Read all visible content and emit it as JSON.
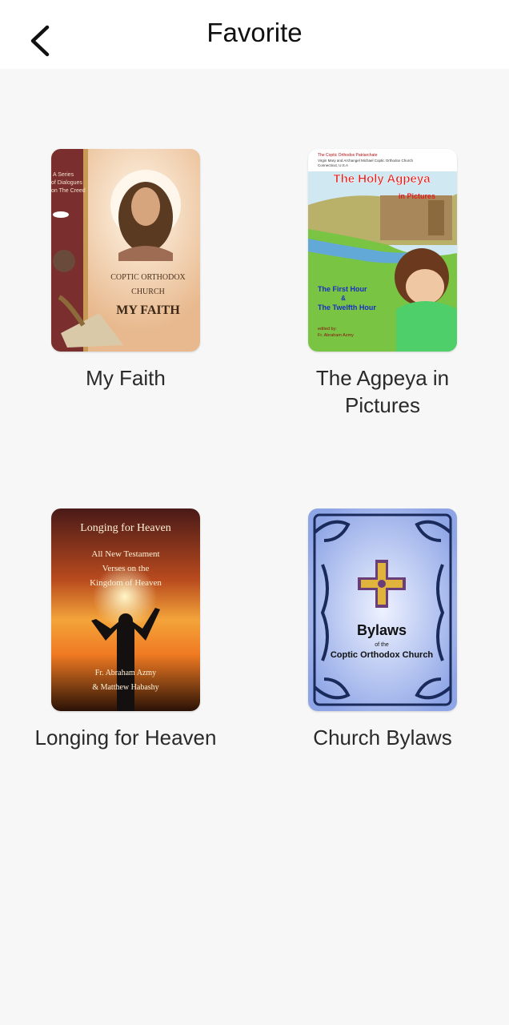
{
  "header": {
    "title": "Favorite",
    "back_icon": "chevron-left-icon"
  },
  "books": [
    {
      "title": "My Faith",
      "cover": {
        "series": [
          "A Series",
          "of Dialogues",
          "on The Creed"
        ],
        "line1": "COPTIC ORTHODOX",
        "line2": "CHURCH",
        "line3": "MY FAITH"
      }
    },
    {
      "title": "The Agpeya in Pictures",
      "cover": {
        "publisher": [
          "The Coptic Orthodox Patriarchate",
          "Virgin Mary and Archangel Michael Coptic Orthodox Church",
          "Connecticut, U.S.A"
        ],
        "heading": "The Holy Agpeya",
        "subheading": "in Pictures",
        "hours": [
          "The First Hour",
          "&",
          "The Twelfth Hour"
        ],
        "edited": "edited by:",
        "editor": "Fr. Abraham Azmy"
      }
    },
    {
      "title": "Longing for Heaven",
      "cover": {
        "heading": "Longing for Heaven",
        "sub": [
          "All New Testament",
          "Verses on the",
          "Kingdom of Heaven"
        ],
        "authors": [
          "Fr. Abraham Azmy",
          "& Matthew Habashy"
        ]
      }
    },
    {
      "title": "Church Bylaws",
      "cover": {
        "heading": "Bylaws",
        "of": "of the",
        "org": "Coptic Orthodox Church"
      }
    }
  ]
}
